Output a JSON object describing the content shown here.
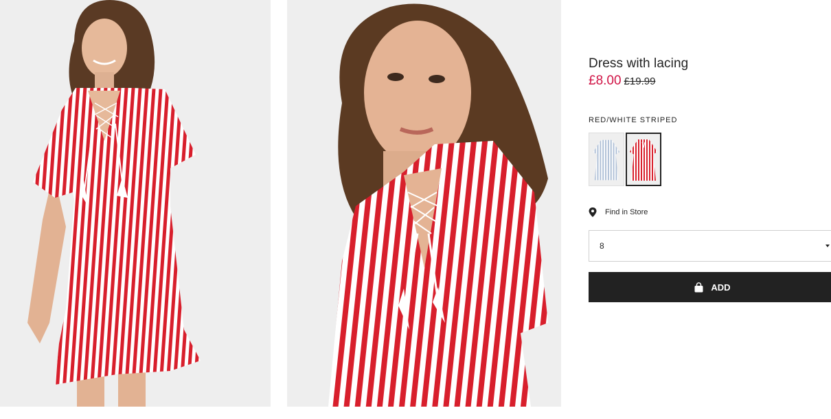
{
  "product": {
    "title": "Dress with lacing",
    "price": "£8.00",
    "old_price": "£19.99",
    "color_label": "RED/WHITE STRIPED",
    "swatches": [
      {
        "name": "light-blue-striped-swatch",
        "selected": false,
        "stripe_color": "#aebfd6"
      },
      {
        "name": "red-white-striped-swatch",
        "selected": true,
        "stripe_color": "#d81f2c"
      }
    ],
    "find_in_store": "Find in Store",
    "size": {
      "selected": "8"
    },
    "add_button": "ADD"
  },
  "icons": [
    "location-pin-icon",
    "chevron-down-icon",
    "shopping-bag-icon"
  ],
  "colors": {
    "price_sale": "#d01345",
    "button_bg": "#222222",
    "dress_red": "#d81f2c",
    "photo_bg": "#eeeeee"
  }
}
